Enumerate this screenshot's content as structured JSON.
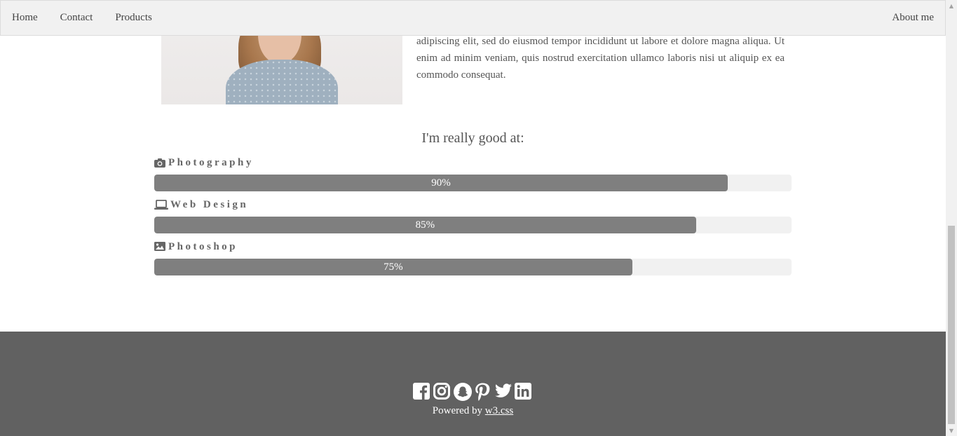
{
  "nav": {
    "home": "Home",
    "contact": "Contact",
    "products": "Products",
    "about": "About me"
  },
  "about": {
    "bio": "adipiscing elit, sed do eiusmod tempor incididunt ut labore et dolore magna aliqua. Ut enim ad minim veniam, quis nostrud exercitation ullamco laboris nisi ut aliquip ex ea commodo consequat."
  },
  "skills": {
    "title": "I'm really good at:",
    "items": [
      {
        "label": "Photography",
        "icon": "camera-icon",
        "percent": 90,
        "percent_label": "90%"
      },
      {
        "label": "Web Design",
        "icon": "laptop-icon",
        "percent": 85,
        "percent_label": "85%"
      },
      {
        "label": "Photoshop",
        "icon": "image-icon",
        "percent": 75,
        "percent_label": "75%"
      }
    ]
  },
  "footer": {
    "social_icons": [
      "facebook-icon",
      "instagram-icon",
      "snapchat-icon",
      "pinterest-icon",
      "twitter-icon",
      "linkedin-icon"
    ],
    "powered_prefix": "Powered by ",
    "powered_link": "w3.css"
  },
  "colors": {
    "navbar_bg": "#f1f1f1",
    "bar_fill": "#7f7f7f",
    "bar_track": "#f1f1f1",
    "footer_bg": "#616161"
  }
}
